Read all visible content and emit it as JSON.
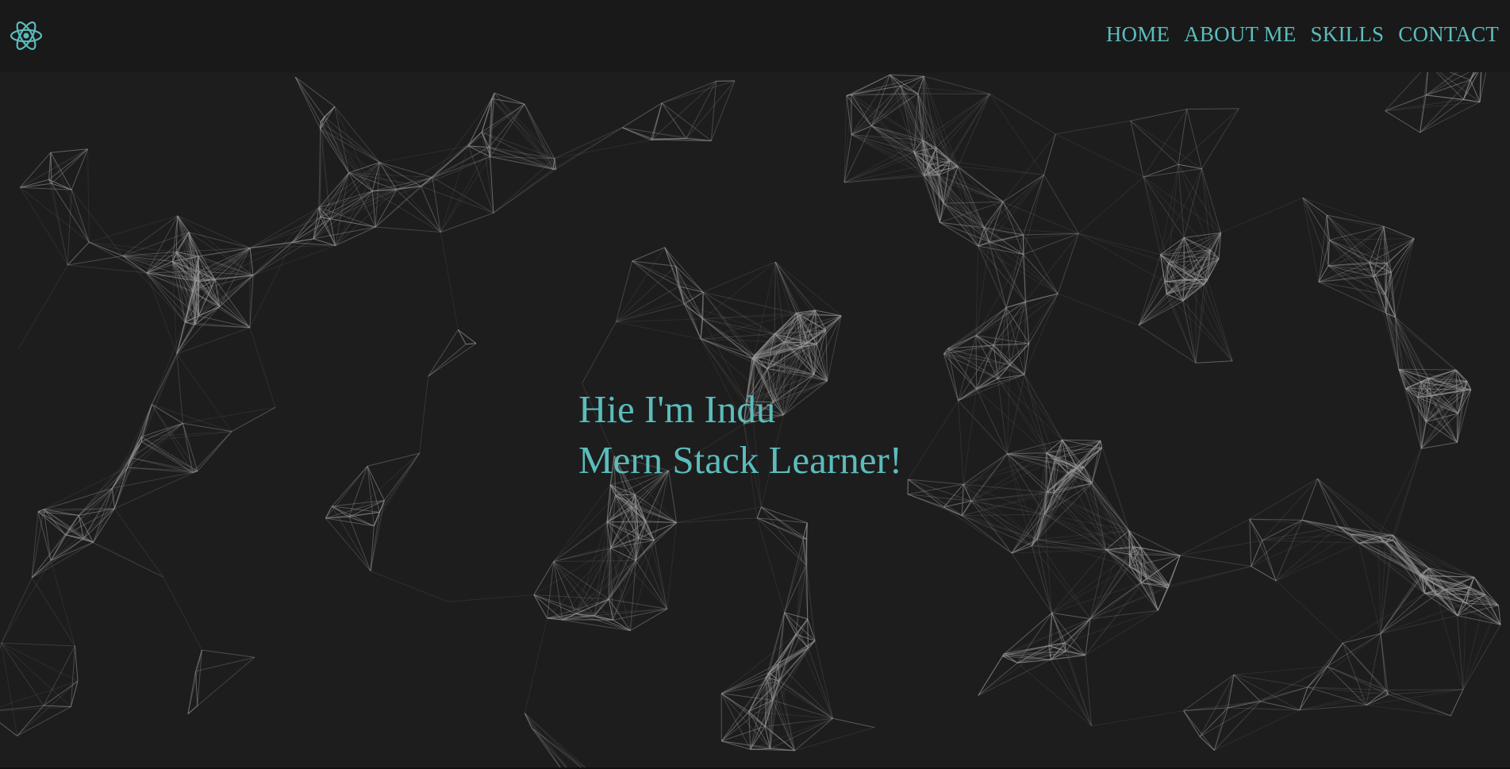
{
  "logo": {
    "icon": "react-atom-icon",
    "color": "#5cbcbc"
  },
  "nav": {
    "items": [
      {
        "label": "HOME"
      },
      {
        "label": "ABOUT ME"
      },
      {
        "label": "SKILLS"
      },
      {
        "label": "CONTACT"
      }
    ]
  },
  "hero": {
    "line1": "Hie I'm Indu",
    "line2": "Mern Stack Learner!"
  },
  "theme": {
    "background": "#1d1d1d",
    "navbar": "#191919",
    "accent": "#5cbcbc",
    "particle_line": "#9a9a9a"
  }
}
